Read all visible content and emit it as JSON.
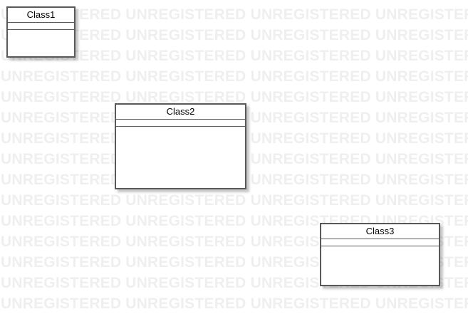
{
  "watermark": {
    "text": "UNREGISTERED UNREGISTERED UNREGISTERED UNREGISTERED UNREGISTERED",
    "color": "#efefef"
  },
  "diagram": {
    "classes": [
      {
        "name": "Class1"
      },
      {
        "name": "Class2"
      },
      {
        "name": "Class3"
      }
    ]
  },
  "colors": {
    "border": "#595959",
    "background": "#ffffff"
  }
}
